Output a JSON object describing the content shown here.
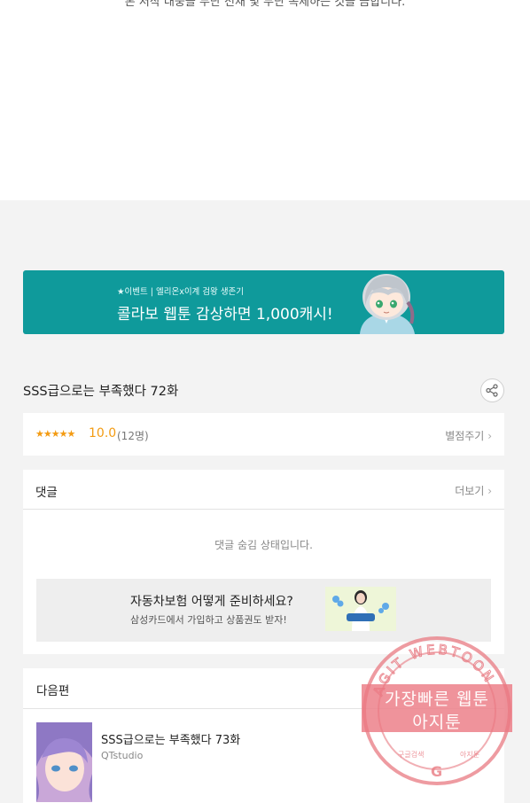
{
  "article": {
    "cut_text": "본 저작 대중을 무단 전재 및 무단 복제하는 것을 금합니다."
  },
  "banner": {
    "small_text": "★이벤트 | 엘리온x이계 검왕 생존기",
    "big_text": "콜라보 웹툰 감상하면 1,000캐시!"
  },
  "episode": {
    "title": "SSS급으로는 부족했다 72화"
  },
  "rating": {
    "stars": "★★★★★",
    "score": "10.0",
    "count": "(12명)",
    "rate_link": "별점주기",
    "value": 10.0
  },
  "comments": {
    "label": "댓글",
    "more_link": "더보기",
    "hidden_message": "댓글 숨김 상태입니다."
  },
  "ad": {
    "title": "자동차보험 어떻게 준비하세요?",
    "subtitle": "삼성카드에서 가입하고 상품권도 받자!"
  },
  "next": {
    "label": "다음편",
    "title": "SSS급으로는 부족했다 73화",
    "author": "QTstudio"
  },
  "watermark": {
    "ring_text": "AGIT WEBTOON",
    "line1": "가장빠른 웹툰",
    "line2": "아지툰",
    "bottom_left": "구글검색",
    "bottom_right": "아지툰"
  },
  "colors": {
    "banner_bg": "#0f9a9b",
    "star": "#f39b12",
    "watermark": "#e87a82"
  },
  "icons": {
    "share": "share-icon",
    "chevron": "chevron-right-icon"
  }
}
